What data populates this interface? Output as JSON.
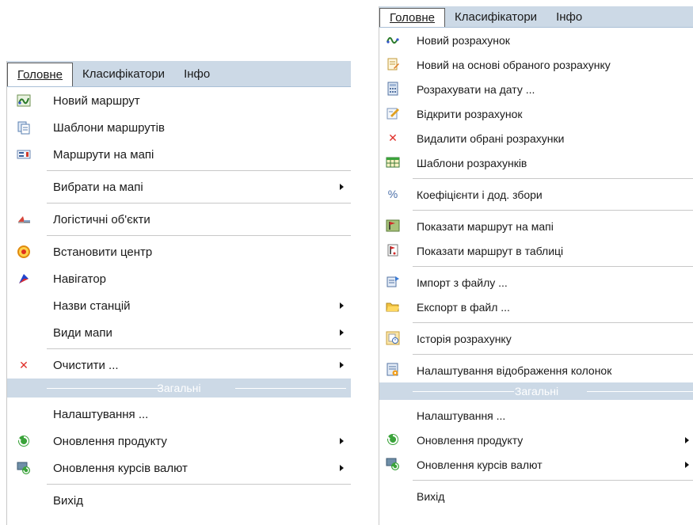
{
  "left_menu": {
    "tabs": [
      "Головне",
      "Класифікатори",
      "Інфо"
    ],
    "items": [
      {
        "label": "Новий маршрут",
        "icon": "route-wave-icon"
      },
      {
        "label": "Шаблони маршрутів",
        "icon": "templates-icon"
      },
      {
        "label": "Маршрути на мапі",
        "icon": "map-routes-icon"
      },
      {
        "label": "Вибрати на мапі",
        "submenu": true
      },
      {
        "label": "Логістичні об'єкти",
        "icon": "logistics-icon"
      },
      {
        "label": "Встановити центр",
        "icon": "center-target-icon"
      },
      {
        "label": "Навігатор",
        "icon": "navigator-icon"
      },
      {
        "label": "Назви станцій",
        "submenu": true
      },
      {
        "label": "Види мапи",
        "submenu": true
      },
      {
        "label": "Очистити ...",
        "icon": "clear-x-icon",
        "submenu": true
      },
      {
        "label": "Налаштування ..."
      },
      {
        "label": "Оновлення продукту",
        "icon": "update-icon",
        "submenu": true
      },
      {
        "label": "Оновлення курсів валют",
        "icon": "currency-update-icon",
        "submenu": true
      },
      {
        "label": "Вихід"
      }
    ],
    "section_label": "Загальні"
  },
  "right_menu": {
    "tabs": [
      "Головне",
      "Класифікатори",
      "Інфо"
    ],
    "items": [
      {
        "label": "Новий розрахунок",
        "icon": "route-wave-icon"
      },
      {
        "label": "Новий на основі обраного розрахунку",
        "icon": "document-edit-icon"
      },
      {
        "label": "Розрахувати на дату ...",
        "icon": "calculator-icon"
      },
      {
        "label": "Відкрити розрахунок",
        "icon": "open-calc-icon"
      },
      {
        "label": "Видалити обрані розрахунки",
        "icon": "delete-x-icon"
      },
      {
        "label": "Шаблони розрахунків",
        "icon": "table-template-icon"
      },
      {
        "label": "Коефіцієнти і дод. збори",
        "icon": "percent-icon"
      },
      {
        "label": "Показати маршрут на мапі",
        "icon": "map-flag-icon"
      },
      {
        "label": "Показати маршрут в таблиці",
        "icon": "table-flag-icon"
      },
      {
        "label": "Імпорт з файлу ...",
        "icon": "import-icon"
      },
      {
        "label": "Експорт в файл ...",
        "icon": "folder-export-icon"
      },
      {
        "label": "Історія розрахунку",
        "icon": "history-icon"
      },
      {
        "label": "Налаштування відображення колонок",
        "icon": "columns-settings-icon"
      },
      {
        "label": "Налаштування ..."
      },
      {
        "label": "Оновлення продукту",
        "icon": "update-icon",
        "submenu": true
      },
      {
        "label": "Оновлення курсів валют",
        "icon": "currency-update-icon",
        "submenu": true
      },
      {
        "label": "Вихід"
      }
    ],
    "section_label": "Загальні"
  },
  "colors": {
    "menubar_bg": "#ccd9e6",
    "separator": "#c8c8c8",
    "delete_red": "#e0302a",
    "update_green": "#3aa33a"
  }
}
